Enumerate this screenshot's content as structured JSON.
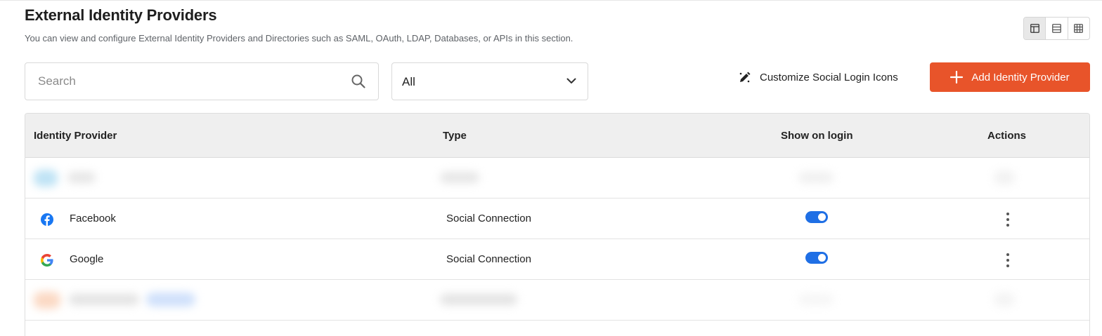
{
  "page": {
    "title": "External Identity Providers",
    "subtitle": "You can view and configure External Identity Providers and Directories such as SAML, OAuth, LDAP, Databases, or APIs in this section."
  },
  "view_toggle": {
    "options": [
      "layout-icon",
      "list-icon",
      "grid-icon"
    ],
    "active": 0
  },
  "search": {
    "placeholder": "Search",
    "value": ""
  },
  "filter": {
    "selected": "All"
  },
  "customize": {
    "label": "Customize Social Login Icons",
    "icon": "edit-icon"
  },
  "add_button": {
    "label": "Add Identity Provider",
    "icon": "plus-icon"
  },
  "table": {
    "columns": [
      "Identity Provider",
      "Type",
      "Show on login",
      "Actions"
    ],
    "rows": [
      {
        "provider": "",
        "type": "",
        "blurred": true
      },
      {
        "provider": "Facebook",
        "type": "Social Connection",
        "show_on_login": true,
        "icon": "facebook-icon"
      },
      {
        "provider": "Google",
        "type": "Social Connection",
        "show_on_login": true,
        "icon": "google-icon"
      },
      {
        "provider": "",
        "type": "",
        "blurred": true
      }
    ]
  },
  "colors": {
    "accent": "#e8542a",
    "toggle_on": "#1f6fe5",
    "header_bg": "#efefef"
  }
}
